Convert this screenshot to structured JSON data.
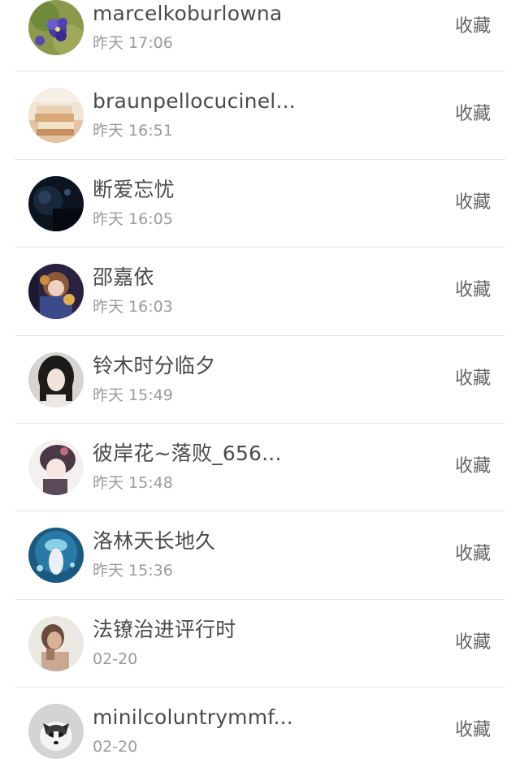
{
  "contacts": [
    {
      "name": "marcelkoburlowna",
      "time": "昨天 17:06",
      "action": "收藏",
      "avatar": "purple-flowers-avatar"
    },
    {
      "name": "braunpellocucinel...",
      "time": "昨天 16:51",
      "action": "收藏",
      "avatar": "books-avatar"
    },
    {
      "name": "断爱忘忧",
      "time": "昨天 16:05",
      "action": "收藏",
      "avatar": "dark-night-avatar"
    },
    {
      "name": "邵嘉依",
      "time": "昨天 16:03",
      "action": "收藏",
      "avatar": "anime-girl-avatar"
    },
    {
      "name": "铃木时分临夕",
      "time": "昨天 15:49",
      "action": "收藏",
      "avatar": "portrait-girl-avatar"
    },
    {
      "name": "彼岸花~落败_656...",
      "time": "昨天 15:48",
      "action": "收藏",
      "avatar": "anime-boy-avatar"
    },
    {
      "name": "洛林天长地久",
      "time": "昨天 15:36",
      "action": "收藏",
      "avatar": "blue-anime-avatar"
    },
    {
      "name": "法镣治进评行时",
      "time": "02-20",
      "action": "收藏",
      "avatar": "woman-photo-avatar"
    },
    {
      "name": "minilcoluntrymmf...",
      "time": "02-20",
      "action": "收藏",
      "avatar": "husky-dog-avatar"
    }
  ]
}
